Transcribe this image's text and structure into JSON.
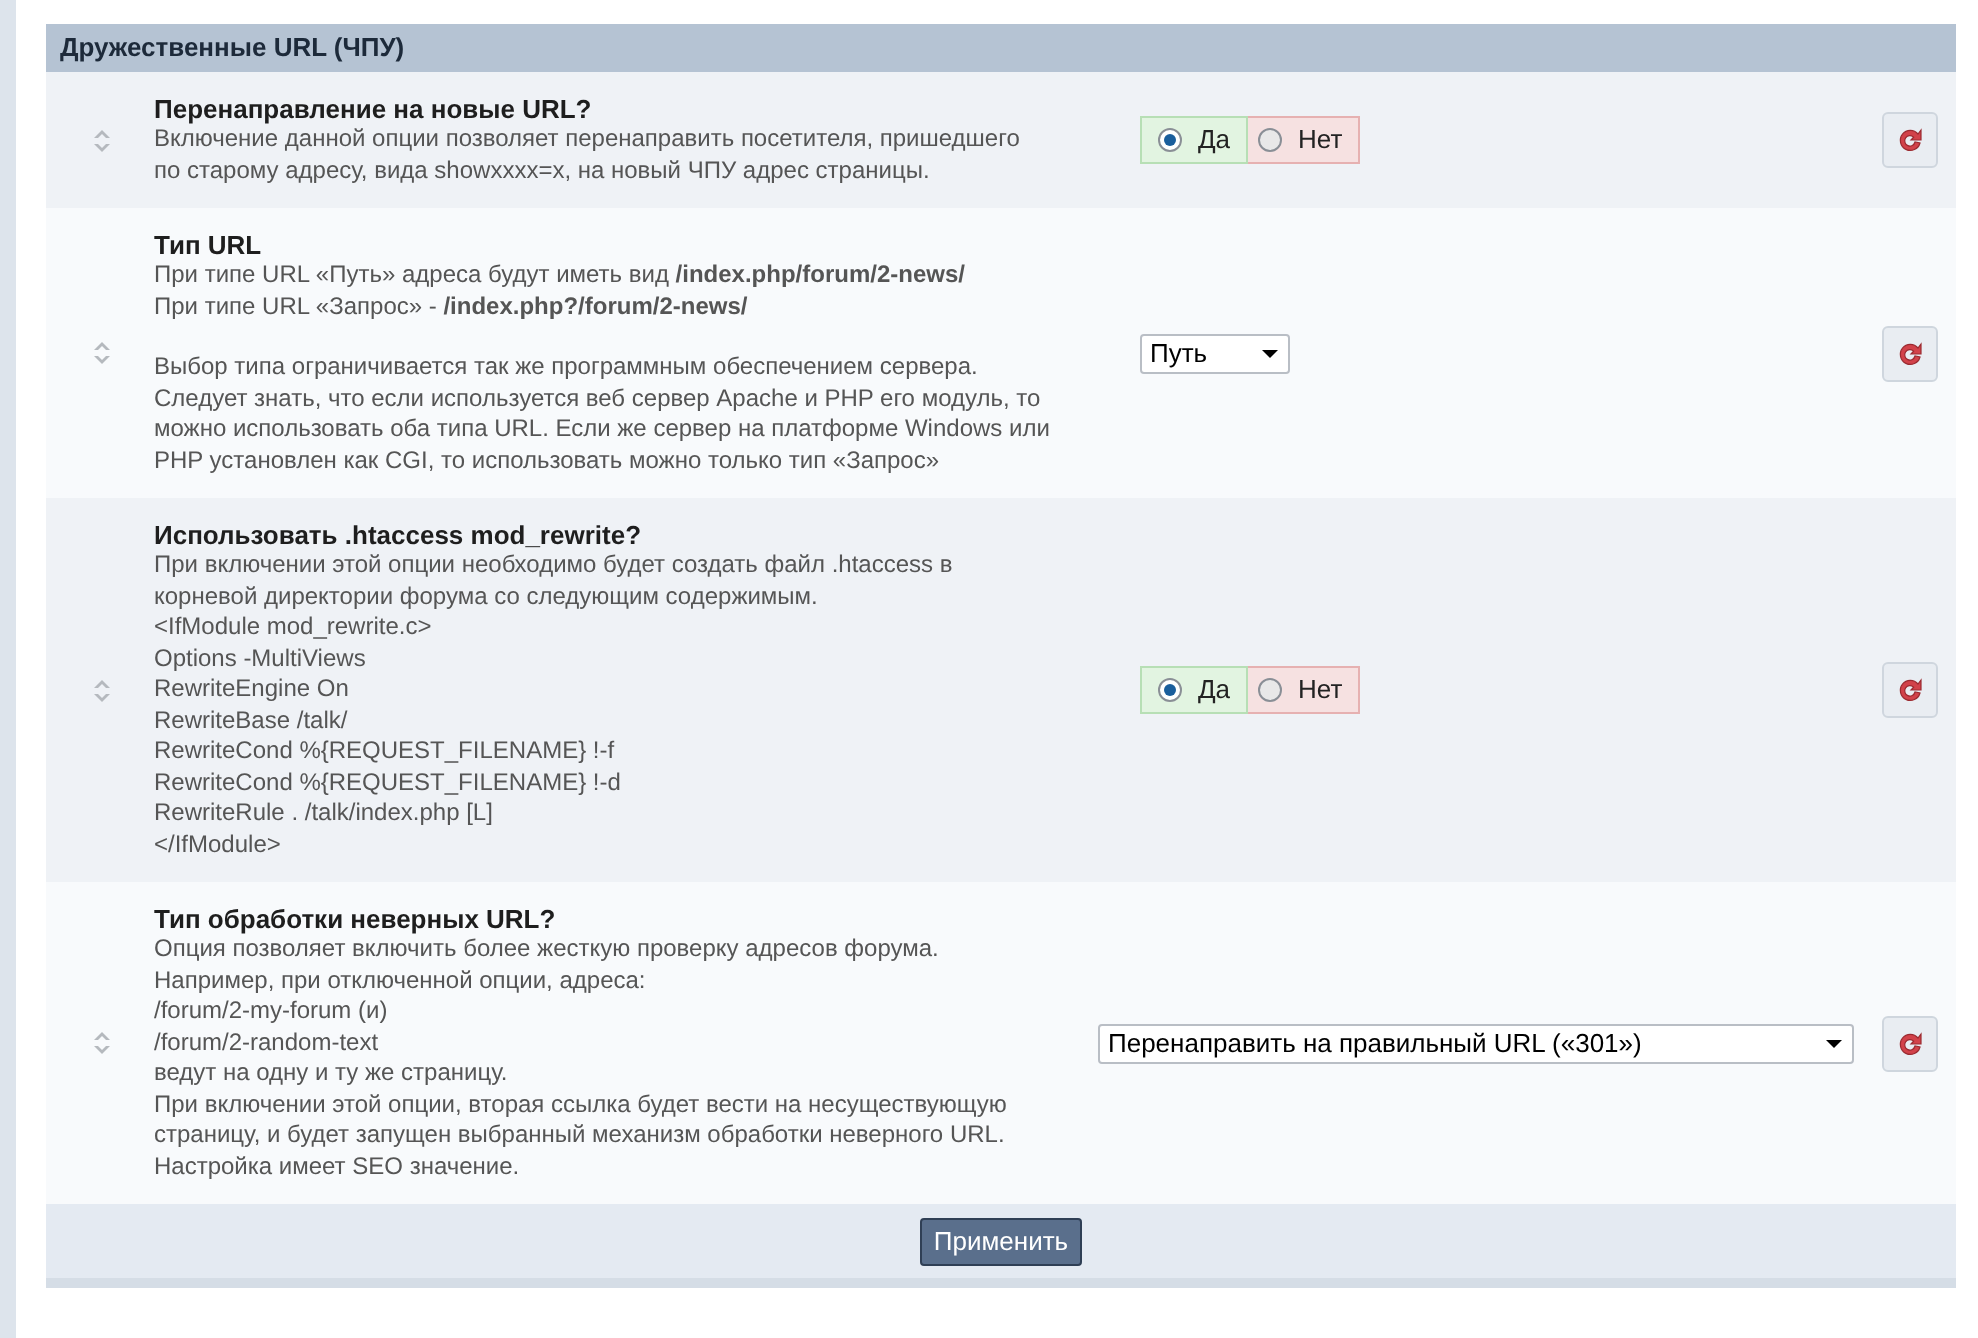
{
  "section": {
    "title": "Дружественные URL (ЧПУ)"
  },
  "settings": [
    {
      "title": "Перенаправление на новые URL?",
      "description": [
        [
          "Включение данной опции позволяет перенаправить посетителя, пришедшего по старому адресу, вида showxxxx=x, на новый ЧПУ адрес страницы."
        ]
      ],
      "control": {
        "kind": "radio",
        "options": [
          {
            "label": "Да",
            "selected": true
          },
          {
            "label": "Нет",
            "selected": false
          }
        ]
      }
    },
    {
      "title": "Тип URL",
      "description": [
        [
          "При типе URL «Путь» адреса будут иметь вид **/index.php/forum/2-news/**",
          "При типе URL «Запрос» - **/index.php?/forum/2-news/**"
        ],
        [
          "Выбор типа ограничивается так же программным обеспечением сервера. Следует знать, что если используется веб сервер Apache и PHP его модуль, то можно использовать оба типа URL. Если же сервер на платформе Windows или PHP установлен как CGI, то использовать можно только тип «Запрос»"
        ]
      ],
      "control": {
        "kind": "select",
        "value": "Путь"
      }
    },
    {
      "title": "Использовать .htaccess mod_rewrite?",
      "description": [
        [
          "При включении этой опции необходимо будет создать файл .htaccess в корневой директории форума со следующим содержимым.",
          "<IfModule mod_rewrite.c>",
          "Options -MultiViews",
          "RewriteEngine On",
          "RewriteBase /talk/",
          "RewriteCond %{REQUEST_FILENAME} !-f",
          "RewriteCond %{REQUEST_FILENAME} !-d",
          "RewriteRule . /talk/index.php [L]",
          "</IfModule>"
        ]
      ],
      "control": {
        "kind": "radio",
        "options": [
          {
            "label": "Да",
            "selected": true
          },
          {
            "label": "Нет",
            "selected": false
          }
        ]
      }
    },
    {
      "title": "Тип обработки неверных URL?",
      "description": [
        [
          "Опция позволяет включить более жесткую проверку адресов форума.",
          "Например, при отключенной опции, адреса:",
          "/forum/2-my-forum (и)",
          "/forum/2-random-text",
          "ведут на одну и ту же страницу.",
          "При включении этой опции, вторая ссылка будет вести на несуществующую страницу, и будет запущен выбранный механизм обработки неверного URL. Настройка имеет SEO значение."
        ]
      ],
      "control": {
        "kind": "wide_select",
        "value": "Перенаправить на правильный URL («301»)"
      }
    }
  ],
  "apply_button": "Применить"
}
